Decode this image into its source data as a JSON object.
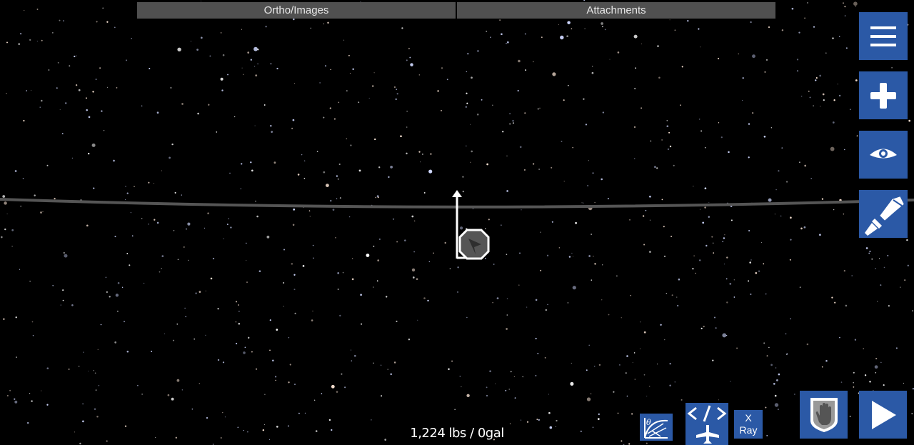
{
  "tabs": [
    {
      "label": "Ortho/Images"
    },
    {
      "label": "Attachments"
    }
  ],
  "status": {
    "mass_fuel": "1,224 lbs / 0gal"
  },
  "xray": {
    "line1": "X",
    "line2": "Ray"
  },
  "colors": {
    "button_blue": "#2b59a6",
    "tab_gray": "#505050",
    "horizon": "#555555"
  },
  "icons": {
    "menu": "hamburger-menu-icon",
    "add": "plus-icon",
    "view": "eye-icon",
    "paint": "paint-brush-icon",
    "trajectory": "trajectory-icon",
    "code": "code-airplane-icon",
    "hand": "hand-icon",
    "play": "play-icon",
    "craft": "craft-pod-icon"
  }
}
